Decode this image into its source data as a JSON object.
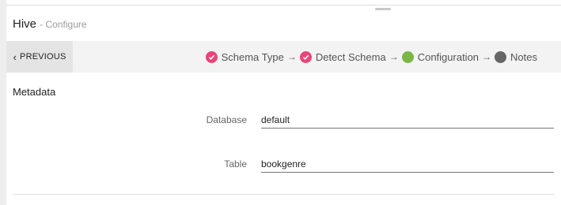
{
  "header": {
    "title": "Hive",
    "subtitle": "- Configure"
  },
  "wizard": {
    "previous_label": "PREVIOUS",
    "steps": [
      {
        "label": "Schema Type",
        "state": "done"
      },
      {
        "label": "Detect Schema",
        "state": "done"
      },
      {
        "label": "Configuration",
        "state": "current"
      },
      {
        "label": "Notes",
        "state": "todo"
      }
    ],
    "separator": "→"
  },
  "section": {
    "title": "Metadata"
  },
  "fields": {
    "database": {
      "label": "Database",
      "value": "default"
    },
    "table": {
      "label": "Table",
      "value": "bookgenre"
    }
  },
  "colors": {
    "done": "#e8457a",
    "current": "#7ab648",
    "todo": "#666666",
    "bar": "#f3f3f3"
  }
}
